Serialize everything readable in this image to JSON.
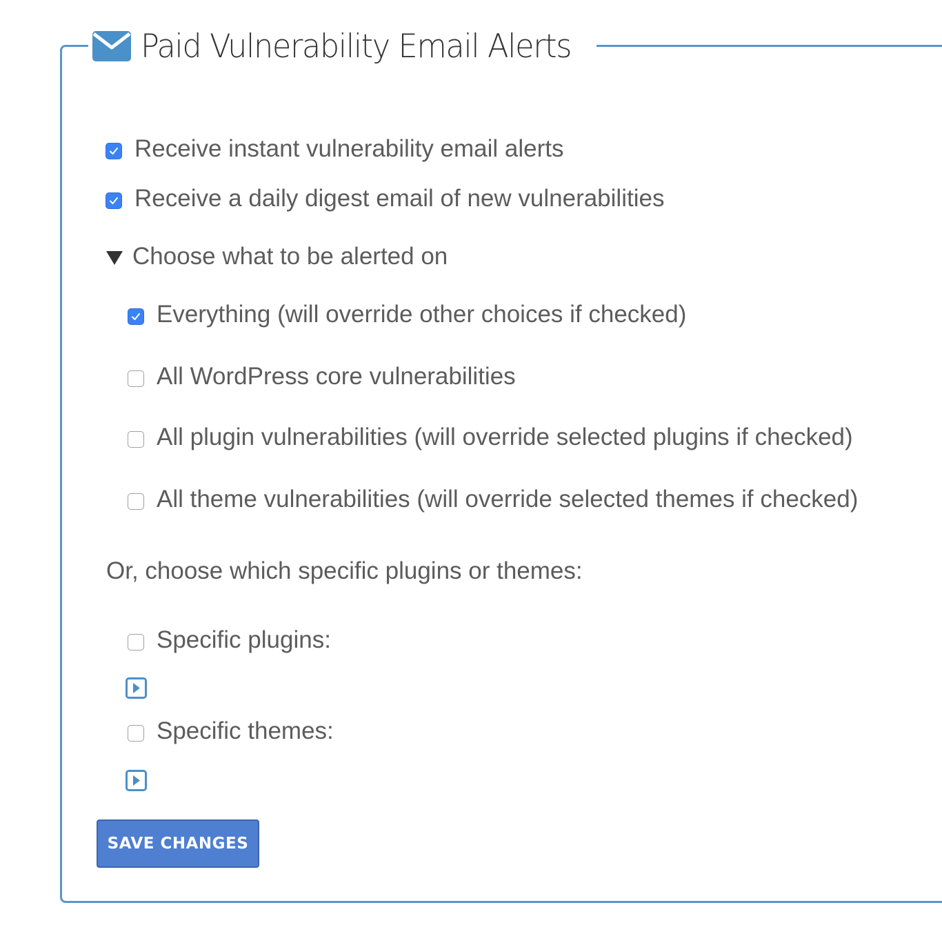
{
  "panel": {
    "title": "Paid Vulnerability Email Alerts",
    "icon": "envelope-icon",
    "border_color": "#5a96c6"
  },
  "options": {
    "instant_alerts": {
      "label": "Receive instant vulnerability email alerts",
      "checked": true
    },
    "daily_digest": {
      "label": "Receive a daily digest email of new vulnerabilities",
      "checked": true
    }
  },
  "alert_choices": {
    "summary": "Choose what to be alerted on",
    "expanded": true,
    "items": [
      {
        "label": "Everything (will override other choices if checked)",
        "checked": true
      },
      {
        "label": "All WordPress core vulnerabilities",
        "checked": false
      },
      {
        "label": "All plugin vulnerabilities (will override selected plugins if checked)",
        "checked": false
      },
      {
        "label": "All theme vulnerabilities (will override selected themes if checked)",
        "checked": false
      }
    ]
  },
  "specific": {
    "heading": "Or, choose which specific plugins or themes:",
    "plugins": {
      "label": "Specific plugins:",
      "checked": false
    },
    "themes": {
      "label": "Specific themes:",
      "checked": false
    }
  },
  "actions": {
    "save_label": "SAVE CHANGES",
    "button_color": "#4e7fd1"
  },
  "colors": {
    "checkbox_checked": "#3b82f6",
    "text": "#5c5c5c",
    "accent": "#4a90c9"
  }
}
